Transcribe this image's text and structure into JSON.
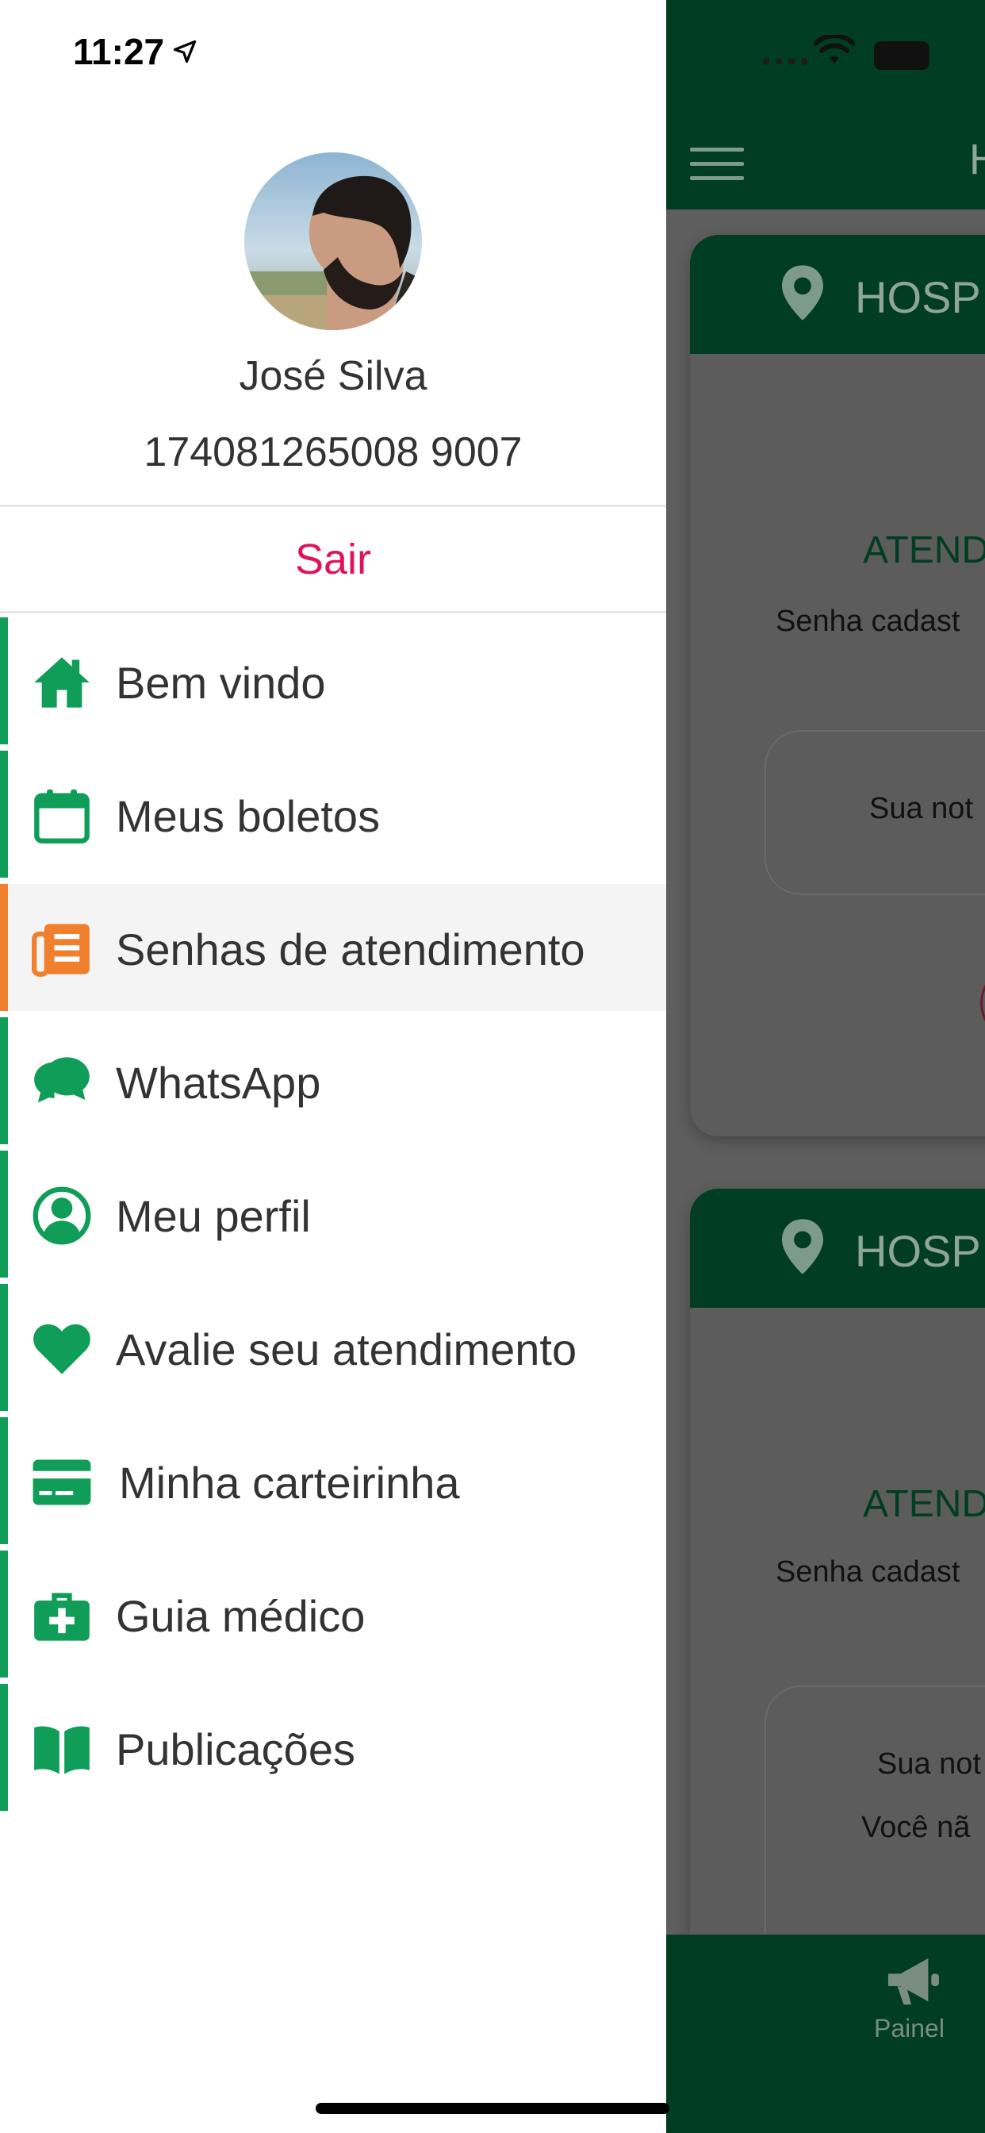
{
  "status_bar": {
    "time": "11:27"
  },
  "user": {
    "name": "José Silva",
    "id": "174081265008 9007"
  },
  "logout_label": "Sair",
  "menu": {
    "items": [
      {
        "label": "Bem vindo",
        "icon": "home-icon",
        "active": false
      },
      {
        "label": "Meus boletos",
        "icon": "calendar-icon",
        "active": false
      },
      {
        "label": "Senhas de atendimento",
        "icon": "list-icon",
        "active": true
      },
      {
        "label": "WhatsApp",
        "icon": "whatsapp-icon",
        "active": false
      },
      {
        "label": "Meu perfil",
        "icon": "user-circle-icon",
        "active": false
      },
      {
        "label": "Avalie seu atendimento",
        "icon": "heart-icon",
        "active": false
      },
      {
        "label": "Minha carteirinha",
        "icon": "credit-card-icon",
        "active": false
      },
      {
        "label": "Guia médico",
        "icon": "medkit-icon",
        "active": false
      },
      {
        "label": "Publicações",
        "icon": "book-icon",
        "active": false
      }
    ]
  },
  "background_app": {
    "header_title": "H",
    "cards": [
      {
        "hospital": "HOSP",
        "status": "ATEND",
        "senha_text": "Senha cadast",
        "note_lines": [
          "Sua not"
        ]
      },
      {
        "hospital": "HOSP",
        "status": "ATEND",
        "senha_text": "Senha cadast",
        "note_lines": [
          "Sua not",
          "Você nã"
        ]
      }
    ],
    "bottom_tab": {
      "label": "Painel",
      "icon": "megaphone-icon"
    }
  },
  "colors": {
    "brand_green": "#0f9d58",
    "header_green": "#003d22",
    "active_orange": "#f07f2e",
    "logout_red": "#e0115f"
  }
}
